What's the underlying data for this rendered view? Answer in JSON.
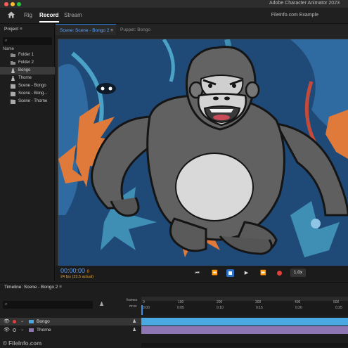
{
  "app": {
    "title": "Adobe Character Animator 2023"
  },
  "menubar": {
    "tabs": [
      "Rig",
      "Record",
      "Stream"
    ],
    "active_tab": "Record",
    "workspace_label": "FileInfo.com Example"
  },
  "project": {
    "title": "Project",
    "column_name": "Name",
    "items": [
      {
        "label": "Folder 1",
        "icon": "folder-icon"
      },
      {
        "label": "Folder 2",
        "icon": "folder-icon"
      },
      {
        "label": "Bongo",
        "icon": "puppet-icon",
        "selected": true
      },
      {
        "label": "Thorne",
        "icon": "puppet-icon"
      },
      {
        "label": "Scene - Bongo",
        "icon": "scene-icon"
      },
      {
        "label": "Scene - Bong...",
        "icon": "scene-icon"
      },
      {
        "label": "Scene - Thorne",
        "icon": "scene-icon"
      }
    ]
  },
  "scene": {
    "tab_active": "Scene: Scene - Bongo 2",
    "tab_other": "Puppet: Bongo"
  },
  "transport": {
    "timecode": "00:00:00",
    "timecode_frame": "0",
    "fps": "24 fps (23.5 actual)",
    "speed": "1.0x"
  },
  "timeline": {
    "title": "Timeline: Scene - Bongo 2",
    "ruler_label_frames": "frames",
    "ruler_label_time": "m:ss",
    "frame_ticks": [
      "0",
      "100",
      "200",
      "300",
      "400",
      "500"
    ],
    "time_ticks": [
      "0:00",
      "0:05",
      "0:10",
      "0:15",
      "0:20",
      "0:25"
    ],
    "rows": [
      {
        "label": "Bongo",
        "track_color": "#4aa9e3",
        "selected": true
      },
      {
        "label": "Thorne",
        "track_color": "#8d76b3"
      }
    ]
  },
  "colors": {
    "accent_blue": "#3d8fe3",
    "stage_bg": "#1f4a78",
    "leaf_orange": "#e07a3a",
    "record_red": "#e0413b"
  },
  "watermark": "© FileInfo.com"
}
